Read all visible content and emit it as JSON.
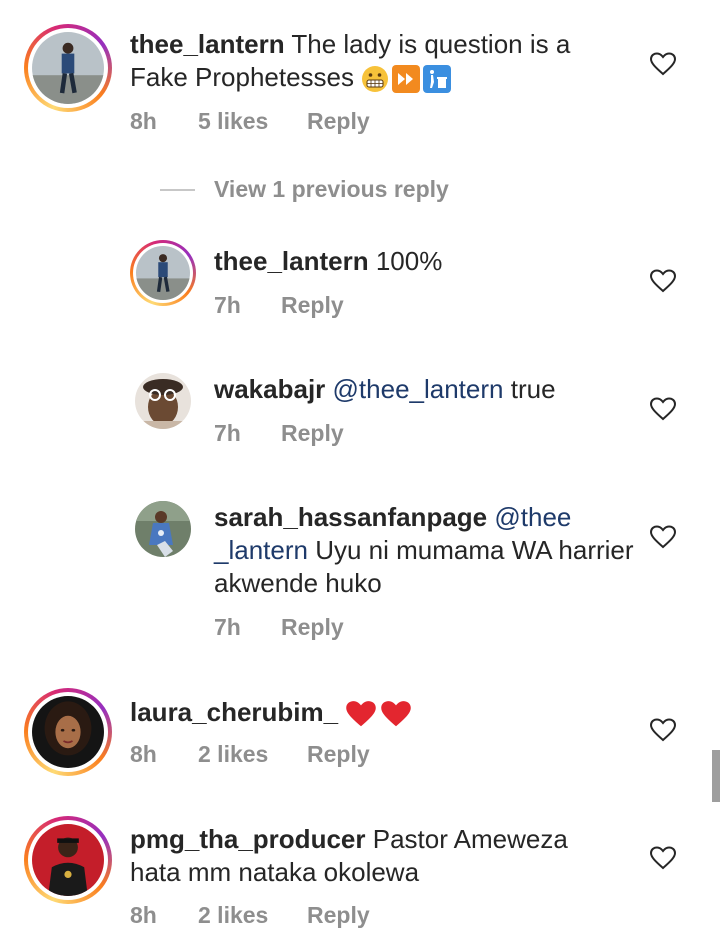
{
  "comments": [
    {
      "username": "thee_lantern",
      "text": "The lady is question is a Fake Prophetesses",
      "emoji": [
        "grimacing-face",
        "fast-forward",
        "put-litter-in-bin"
      ],
      "time": "8h",
      "likes": "5 likes",
      "reply_label": "Reply",
      "view_replies": "View 1 previous reply",
      "replies": [
        {
          "username": "thee_lantern",
          "text": "100%",
          "time": "7h",
          "reply_label": "Reply"
        },
        {
          "username": "wakabajr",
          "mention": "@thee_lantern",
          "text": "true",
          "time": "7h",
          "reply_label": "Reply"
        },
        {
          "username": "sarah_hassanfanpage",
          "mention": "@thee _lantern",
          "text": "Uyu ni mumama WA harrier akwende  huko",
          "time": "7h",
          "reply_label": "Reply"
        }
      ]
    },
    {
      "username": "laura_cherubim_",
      "text": "",
      "emoji": [
        "red-heart",
        "red-heart"
      ],
      "time": "8h",
      "likes": "2 likes",
      "reply_label": "Reply"
    },
    {
      "username": "pmg_tha_producer",
      "text": "Pastor Ameweza hata mm nataka okolewa",
      "time": "8h",
      "likes": "2 likes",
      "reply_label": "Reply"
    }
  ],
  "colors": {
    "text": "#262626",
    "meta": "#8e8e8e",
    "mention": "#1e3a6a",
    "heart_outline": "#262626",
    "emoji_heart": "#e3262f"
  }
}
